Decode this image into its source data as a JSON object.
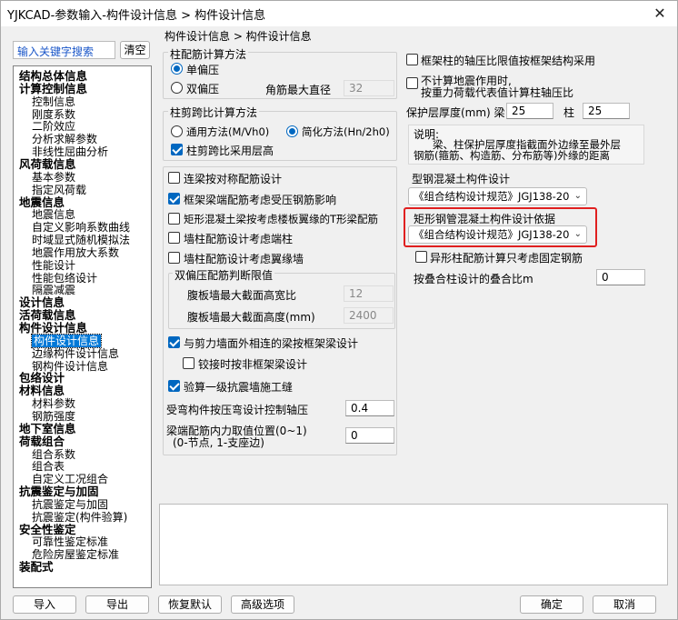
{
  "window": {
    "title": "YJKCAD-参数输入-构件设计信息 > 构件设计信息",
    "close_label": "✕"
  },
  "search": {
    "placeholder": "输入关键字搜索",
    "clear_label": "清空"
  },
  "tree": [
    {
      "label": "结构总体信息",
      "level": 0
    },
    {
      "label": "计算控制信息",
      "level": 0
    },
    {
      "label": "控制信息",
      "level": 1
    },
    {
      "label": "刚度系数",
      "level": 1
    },
    {
      "label": "二阶效应",
      "level": 1
    },
    {
      "label": "分析求解参数",
      "level": 1
    },
    {
      "label": "非线性屈曲分析",
      "level": 1
    },
    {
      "label": "风荷载信息",
      "level": 0
    },
    {
      "label": "基本参数",
      "level": 1
    },
    {
      "label": "指定风荷载",
      "level": 1
    },
    {
      "label": "地震信息",
      "level": 0
    },
    {
      "label": "地震信息",
      "level": 1
    },
    {
      "label": "自定义影响系数曲线",
      "level": 1
    },
    {
      "label": "时域显式随机模拟法",
      "level": 1
    },
    {
      "label": "地震作用放大系数",
      "level": 1
    },
    {
      "label": "性能设计",
      "level": 1
    },
    {
      "label": "性能包络设计",
      "level": 1
    },
    {
      "label": "隔震减震",
      "level": 1
    },
    {
      "label": "设计信息",
      "level": 0
    },
    {
      "label": "活荷载信息",
      "level": 0
    },
    {
      "label": "构件设计信息",
      "level": 0
    },
    {
      "label": "构件设计信息",
      "level": 1,
      "selected": true
    },
    {
      "label": "边缘构件设计信息",
      "level": 1
    },
    {
      "label": "钢构件设计信息",
      "level": 1
    },
    {
      "label": "包络设计",
      "level": 0
    },
    {
      "label": "材料信息",
      "level": 0
    },
    {
      "label": "材料参数",
      "level": 1
    },
    {
      "label": "钢筋强度",
      "level": 1
    },
    {
      "label": "地下室信息",
      "level": 0
    },
    {
      "label": "荷载组合",
      "level": 0
    },
    {
      "label": "组合系数",
      "level": 1
    },
    {
      "label": "组合表",
      "level": 1
    },
    {
      "label": "自定义工况组合",
      "level": 1
    },
    {
      "label": "抗震鉴定与加固",
      "level": 0
    },
    {
      "label": "抗震鉴定与加固",
      "level": 1
    },
    {
      "label": "抗震鉴定(构件验算)",
      "level": 1
    },
    {
      "label": "安全性鉴定",
      "level": 0
    },
    {
      "label": "可靠性鉴定标准",
      "level": 1
    },
    {
      "label": "危险房屋鉴定标准",
      "level": 1
    },
    {
      "label": "装配式",
      "level": 0
    }
  ],
  "breadcrumb": "构件设计信息 > 构件设计信息",
  "column_rebar": {
    "title": "柱配筋计算方法",
    "opt1": "单偏压",
    "opt2": "双偏压",
    "angle_label": "角筋最大直径",
    "angle_value": "32"
  },
  "column_shear": {
    "title": "柱剪跨比计算方法",
    "opt1": "通用方法(M/Vh0)",
    "opt2": "简化方法(Hn/2h0)",
    "check_label": "柱剪跨比采用层高"
  },
  "options": {
    "c1": "连梁按对称配筋设计",
    "c2": "框架梁端配筋考虑受压钢筋影响",
    "c3": "矩形混凝土梁按考虑楼板翼缘的T形梁配筋",
    "c4": "墙柱配筋设计考虑端柱",
    "c5": "墙柱配筋设计考虑翼缘墙",
    "biaxial_title": "双偏压配筋判断限值",
    "ratio_label": "腹板墙最大截面高宽比",
    "ratio_value": "12",
    "height_label": "腹板墙最大截面高度(mm)",
    "height_value": "2400",
    "c6": "与剪力墙面外相连的梁按框架梁设计",
    "c7": "铰接时按非框架梁设计",
    "c8": "验算一级抗震墙施工缝",
    "axial_label": "受弯构件按压弯设计控制轴压",
    "axial_value": "0.4",
    "pos_label1": "梁端配筋内力取值位置(0~1)",
    "pos_label2": "(0-节点, 1-支座边)",
    "pos_value": "0"
  },
  "right": {
    "r1": "框架柱的轴压比限值按框架结构采用",
    "r2a": "不计算地震作用时,",
    "r2b": "按重力荷载代表值计算柱轴压比",
    "cover_label": "保护层厚度(mm) 梁",
    "beam_value": "25",
    "col_label": "柱",
    "col_value": "25",
    "note_title": "说明:",
    "note_line1": "梁、柱保护层厚度指截面外边缘至最外层",
    "note_line2": "钢筋(箍筋、构造筋、分布筋等)外缘的距离",
    "steel_label": "型钢混凝土构件设计",
    "steel_value": "《组合结构设计规范》JGJ138-20",
    "rect_label": "矩形钢管混凝土构件设计依据",
    "rect_value": "《组合结构设计规范》JGJ138-20",
    "special_label": "异形柱配筋计算只考虑固定钢筋",
    "overlap_label": "按叠合柱设计的叠合比m",
    "overlap_value": "0"
  },
  "footer": {
    "import": "导入",
    "export": "导出",
    "restore": "恢复默认",
    "advanced": "高级选项",
    "ok": "确定",
    "cancel": "取消"
  }
}
